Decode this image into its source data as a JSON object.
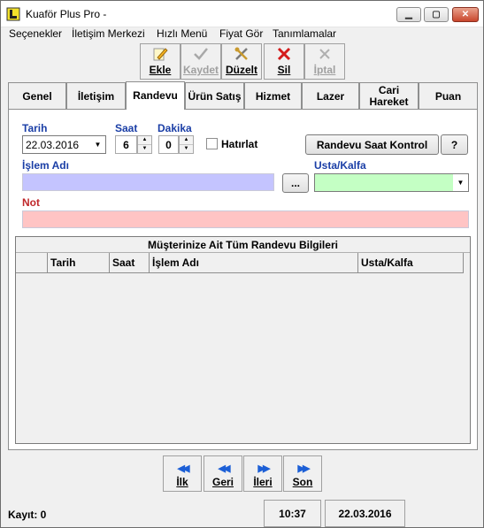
{
  "window": {
    "title": "Kuaför Plus Pro -"
  },
  "menu": [
    "Seçenekler",
    "İletişim Merkezi",
    "Hızlı Menü",
    "Fiyat Gör",
    "Tanımlamalar"
  ],
  "toolbar": {
    "add": "Ekle",
    "save": "Kaydet",
    "edit": "Düzelt",
    "delete": "Sil",
    "cancel": "İptal"
  },
  "tabs": [
    "Genel",
    "İletişim",
    "Randevu",
    "Ürün Satış",
    "Hizmet",
    "Lazer",
    "Cari Hareket",
    "Puan"
  ],
  "form": {
    "date_label": "Tarih",
    "date_value": "22.03.2016",
    "hour_label": "Saat",
    "hour_value": "6",
    "minute_label": "Dakika",
    "minute_value": "0",
    "reminder_label": "Hatırlat",
    "check_button": "Randevu Saat Kontrol",
    "help_button": "?",
    "service_label": "İşlem Adı",
    "browse_button": "...",
    "staff_label": "Usta/Kalfa",
    "note_label": "Not"
  },
  "grid": {
    "title": "Müşterinize Ait Tüm Randevu Bilgileri",
    "columns": [
      "",
      "Tarih",
      "Saat",
      "İşlem Adı",
      "Usta/Kalfa"
    ]
  },
  "nav": {
    "first": "İlk",
    "prev": "Geri",
    "next": "İleri",
    "last": "Son"
  },
  "status": {
    "record": "Kayıt: 0",
    "time": "10:37",
    "date": "22.03.2016"
  },
  "colors": {
    "service_field": "#c4c4ff",
    "staff_field": "#c4ffc4",
    "note_field": "#ffc4c4",
    "label_blue": "#1a3ea6",
    "label_red": "#c0282b",
    "nav_arrow": "#1c5fd6"
  }
}
